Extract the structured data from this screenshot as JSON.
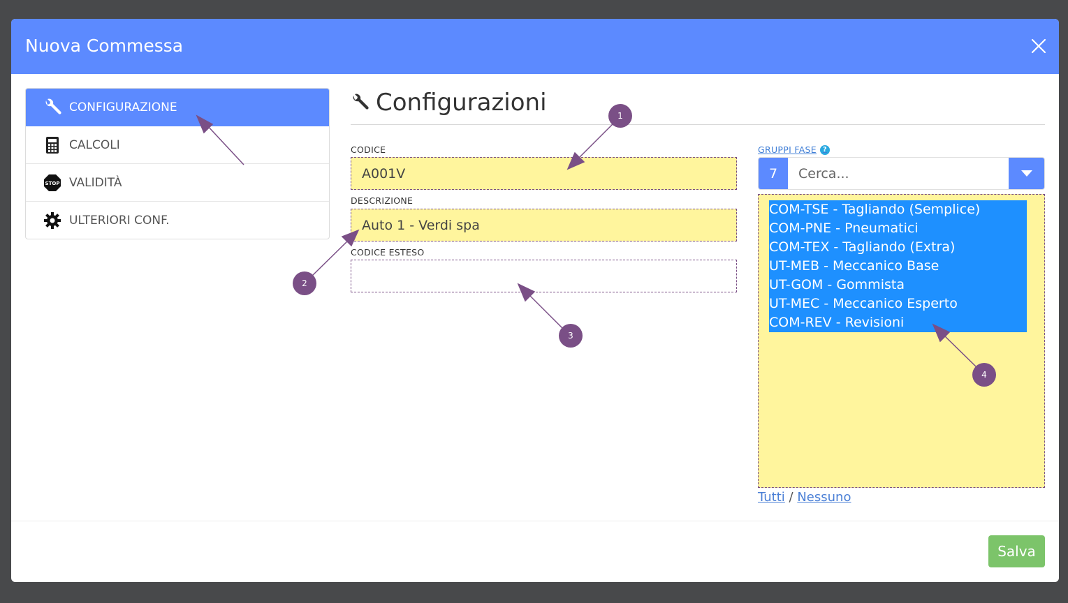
{
  "modal": {
    "title": "Nuova Commessa",
    "close_icon": "close-icon"
  },
  "sidebar": {
    "items": [
      {
        "label": "CONFIGURAZIONE",
        "icon": "wrench-icon",
        "active": true
      },
      {
        "label": "CALCOLI",
        "icon": "calculator-icon",
        "active": false
      },
      {
        "label": "VALIDITÀ",
        "icon": "stop-sign-icon",
        "active": false
      },
      {
        "label": "ULTERIORI CONF.",
        "icon": "gear-icon",
        "active": false
      }
    ],
    "stop_text": "STOP"
  },
  "section": {
    "title": "Configurazioni",
    "icon": "wrench-icon"
  },
  "form": {
    "codice_label": "CODICE",
    "codice_value": "A001V",
    "descrizione_label": "DESCRIZIONE",
    "descrizione_value": "Auto 1 - Verdi spa",
    "codice_esteso_label": "CODICE ESTESO",
    "codice_esteso_value": ""
  },
  "gruppi": {
    "label": "GRUPPI FASE",
    "help": "?",
    "count": "7",
    "search_placeholder": "Cerca...",
    "options": [
      "COM-TSE - Tagliando (Semplice)",
      "COM-PNE - Pneumatici",
      "COM-TEX - Tagliando (Extra)",
      "UT-MEB - Meccanico Base",
      "UT-GOM - Gommista",
      "UT-MEC - Meccanico Esperto",
      "COM-REV - Revisioni"
    ],
    "all_link": "Tutti",
    "separator": "/",
    "none_link": "Nessuno"
  },
  "footer": {
    "save_label": "Salva"
  },
  "annotations": [
    "1",
    "2",
    "3",
    "4"
  ],
  "colors": {
    "accent": "#5c8aff",
    "highlight_field": "#fff59d",
    "selected_option": "#1e90ff",
    "save_button": "#7cc46a",
    "annotation": "#7a4f86"
  }
}
